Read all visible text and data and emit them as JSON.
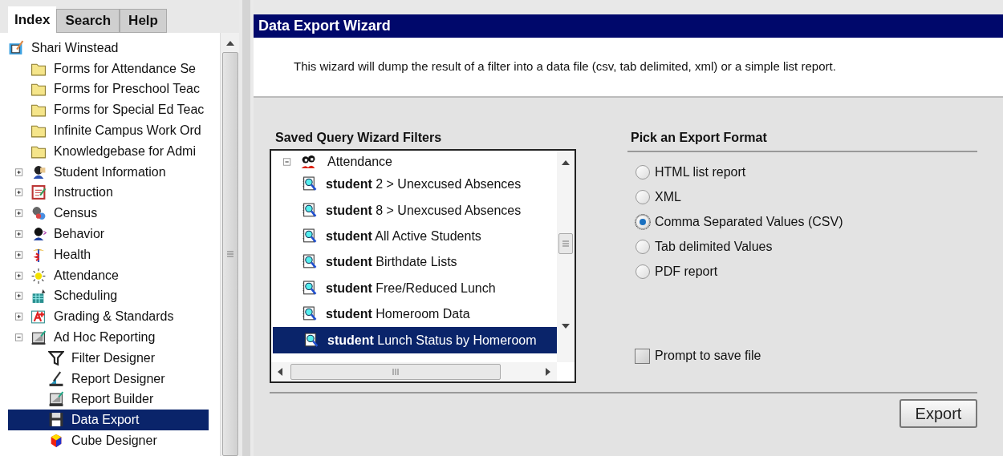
{
  "tabs": [
    {
      "label": "Index",
      "selected": true
    },
    {
      "label": "Search",
      "selected": false
    },
    {
      "label": "Help",
      "selected": false
    }
  ],
  "tree": [
    {
      "label": "Shari Winstead",
      "kind": "user",
      "selected": false,
      "children": [
        {
          "label": "Forms for Attendance Se",
          "kind": "folder",
          "selected": false
        },
        {
          "label": "Forms for Preschool Teac",
          "kind": "folder",
          "selected": false
        },
        {
          "label": "Forms for Special Ed Teac",
          "kind": "folder",
          "selected": false
        },
        {
          "label": "Infinite Campus Work Ord",
          "kind": "folder",
          "selected": false
        },
        {
          "label": "Knowledgebase for Admi",
          "kind": "folder",
          "selected": false
        },
        {
          "label": "Student Information",
          "kind": "module",
          "expanded": false,
          "selected": false
        },
        {
          "label": "Instruction",
          "kind": "module",
          "expanded": false,
          "selected": false
        },
        {
          "label": "Census",
          "kind": "module",
          "expanded": false,
          "selected": false
        },
        {
          "label": "Behavior",
          "kind": "module",
          "expanded": false,
          "selected": false
        },
        {
          "label": "Health",
          "kind": "module",
          "expanded": false,
          "selected": false
        },
        {
          "label": "Attendance",
          "kind": "module",
          "expanded": false,
          "selected": false
        },
        {
          "label": "Scheduling",
          "kind": "module",
          "expanded": false,
          "selected": false
        },
        {
          "label": "Grading & Standards",
          "kind": "module",
          "expanded": false,
          "selected": false
        },
        {
          "label": "Ad Hoc Reporting",
          "kind": "module",
          "expanded": true,
          "selected": false,
          "children": [
            {
              "label": "Filter Designer",
              "kind": "tool",
              "selected": false
            },
            {
              "label": "Report Designer",
              "kind": "tool",
              "selected": false
            },
            {
              "label": "Report Builder",
              "kind": "tool",
              "selected": false
            },
            {
              "label": "Data Export",
              "kind": "tool",
              "selected": true
            },
            {
              "label": "Cube Designer",
              "kind": "tool",
              "selected": false
            }
          ]
        }
      ]
    }
  ],
  "wizard": {
    "title": "Data Export Wizard",
    "intro": "This wizard will dump the result of a filter into a data file (csv, tab delimited, xml) or a simple list report.",
    "filters": {
      "heading": "Saved Query Wizard Filters",
      "group": {
        "label": "Attendance",
        "expanded": true
      },
      "items": [
        {
          "label": "**student** 2 > Unexcused Absences",
          "selected": false
        },
        {
          "label": "**student** 8 > Unexcused Absences",
          "selected": false
        },
        {
          "label": "**student** All Active Students",
          "selected": false
        },
        {
          "label": "**student** Birthdate Lists",
          "selected": false
        },
        {
          "label": "**student** Free/Reduced Lunch",
          "selected": false
        },
        {
          "label": "**student** Homeroom Data",
          "selected": false
        },
        {
          "label": "**student** Lunch Status by Homeroom",
          "selected": true
        }
      ]
    },
    "format": {
      "heading": "Pick an Export Format",
      "options": [
        {
          "label": "HTML list report",
          "selected": false
        },
        {
          "label": "XML",
          "selected": false
        },
        {
          "label": "Comma Separated Values (CSV)",
          "selected": true
        },
        {
          "label": "Tab delimited Values",
          "selected": false
        },
        {
          "label": "PDF report",
          "selected": false
        }
      ]
    },
    "prompt": {
      "label": "Prompt to save file",
      "checked": false
    },
    "button": "Export"
  }
}
